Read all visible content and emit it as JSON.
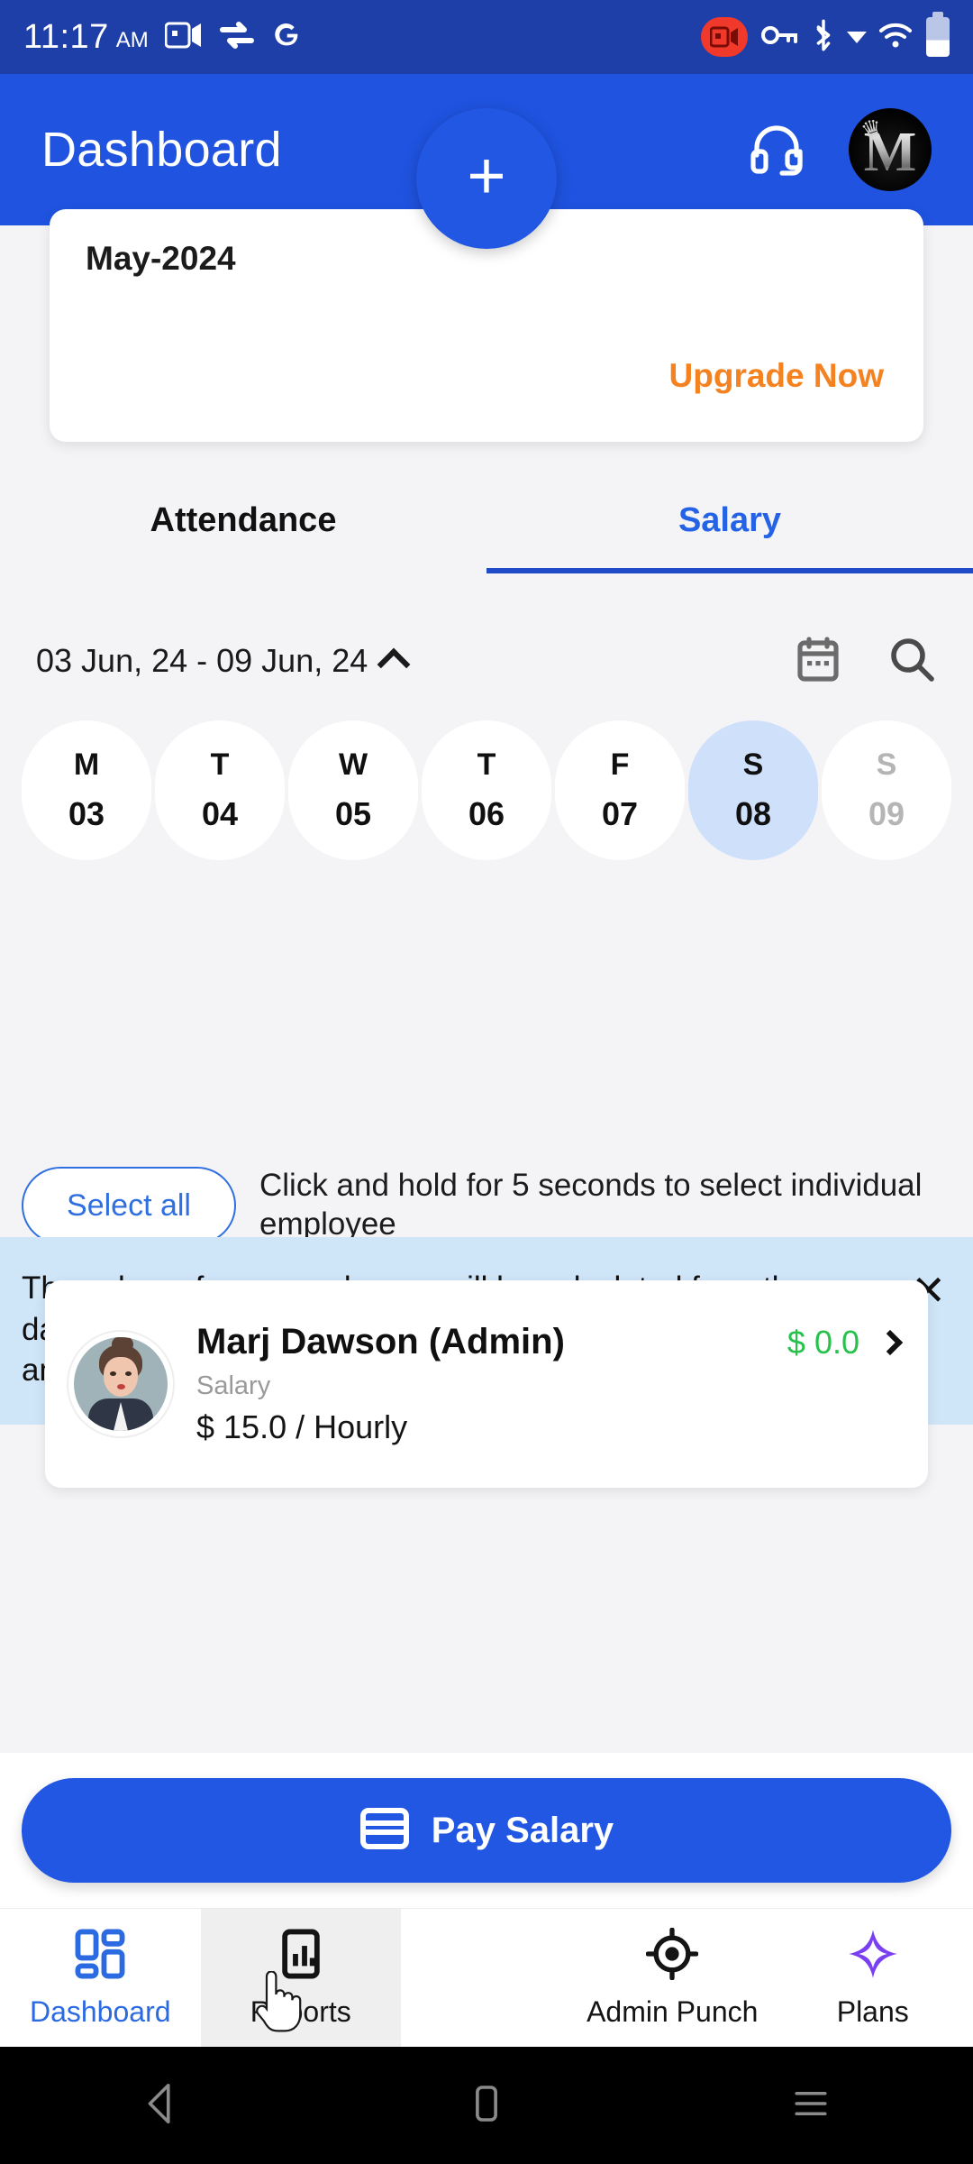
{
  "statusbar": {
    "time": "11:17",
    "ampm": "AM",
    "icons_left": [
      "screen-cast-icon",
      "vpn-swap-icon",
      "google-g-icon"
    ],
    "icons_right": [
      "screen-record-badge-icon",
      "vpn-key-icon",
      "bluetooth-icon",
      "caret-down-icon",
      "wifi-icon",
      "battery-icon"
    ],
    "record_badge_color": "#f0392b",
    "background": "#1f3fa8"
  },
  "appbar": {
    "title": "Dashboard",
    "support_icon": "headset-icon",
    "avatar_letter": "M",
    "background": "#1f53e0"
  },
  "upgrade_card": {
    "month": "May-2024",
    "cta": "Upgrade Now",
    "cta_color": "#f58220"
  },
  "tabs": [
    {
      "label": "Attendance",
      "active": false
    },
    {
      "label": "Salary",
      "active": true
    }
  ],
  "date_range": {
    "label": "03 Jun, 24 - 09 Jun, 24",
    "chevron": "chevron-up-icon",
    "calendar_icon": "calendar-icon",
    "search_icon": "search-icon"
  },
  "days": [
    {
      "dow": "M",
      "num": "03",
      "state": "normal"
    },
    {
      "dow": "T",
      "num": "04",
      "state": "normal"
    },
    {
      "dow": "W",
      "num": "05",
      "state": "normal"
    },
    {
      "dow": "T",
      "num": "06",
      "state": "normal"
    },
    {
      "dow": "F",
      "num": "07",
      "state": "normal"
    },
    {
      "dow": "S",
      "num": "08",
      "state": "selected"
    },
    {
      "dow": "S",
      "num": "09",
      "state": "disabled"
    }
  ],
  "select_all": {
    "button_label": "Select all",
    "hint": "Click and hold for 5 seconds to select individual employee"
  },
  "info_banner": {
    "text": "The salary of your employees will be calculated from the date you have set their particular wage type and salary amount.",
    "close_icon": "close-icon",
    "background": "#cfe5f8"
  },
  "employees": [
    {
      "name": "Marj Dawson (Admin)",
      "amount": "$ 0.0",
      "amount_color": "#27c24c",
      "sub_label": "Salary",
      "rate": "$ 15.0 / Hourly",
      "chevron": "chevron-right-icon"
    }
  ],
  "pay_button": {
    "label": "Pay Salary",
    "icon": "credit-card-icon",
    "color": "#2157e2"
  },
  "fab": {
    "icon": "plus-icon",
    "color": "#2157e2"
  },
  "bottom_nav": [
    {
      "label": "Dashboard",
      "icon": "grid-dashboard-icon",
      "active": true,
      "pressed": false
    },
    {
      "label": "Reports",
      "icon": "report-chart-icon",
      "active": false,
      "pressed": true
    },
    {
      "label": "Admin Punch",
      "icon": "target-punch-icon",
      "active": false,
      "pressed": false
    },
    {
      "label": "Plans",
      "icon": "diamond-plans-icon",
      "active": false,
      "pressed": false
    }
  ],
  "android_nav": [
    "back-icon",
    "home-icon",
    "recents-icon"
  ]
}
